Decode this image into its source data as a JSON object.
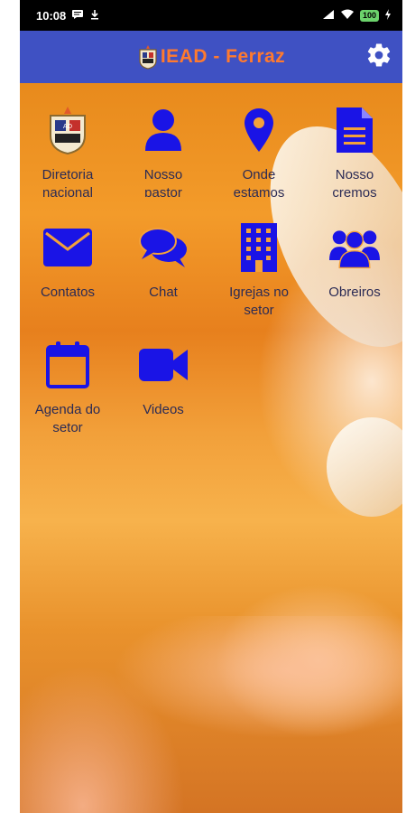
{
  "status_bar": {
    "time": "10:08",
    "battery": "100",
    "icons": [
      "message-icon",
      "download-icon",
      "signal-icon",
      "wifi-icon",
      "battery-icon",
      "charging-icon"
    ]
  },
  "app_bar": {
    "title": "IEAD - Ferraz",
    "title_color": "#ff7a2e",
    "background": "#3f51c3",
    "settings_icon": "gear-icon"
  },
  "menu": [
    {
      "label": "Diretoria nacional",
      "icon": "church-emblem-icon"
    },
    {
      "label": "Nosso pastor",
      "icon": "person-icon"
    },
    {
      "label": "Onde estamos",
      "icon": "location-pin-icon"
    },
    {
      "label": "Nosso cremos",
      "icon": "document-icon"
    },
    {
      "label": "Contatos",
      "icon": "mail-icon"
    },
    {
      "label": "Chat",
      "icon": "chat-bubbles-icon"
    },
    {
      "label": "Igrejas no setor",
      "icon": "building-icon"
    },
    {
      "label": "Obreiros",
      "icon": "group-icon"
    },
    {
      "label": "Agenda do setor",
      "icon": "calendar-icon"
    },
    {
      "label": "Videos",
      "icon": "video-camera-icon"
    }
  ],
  "colors": {
    "icon_blue": "#1a14e6",
    "label_color": "#2b2b55"
  }
}
